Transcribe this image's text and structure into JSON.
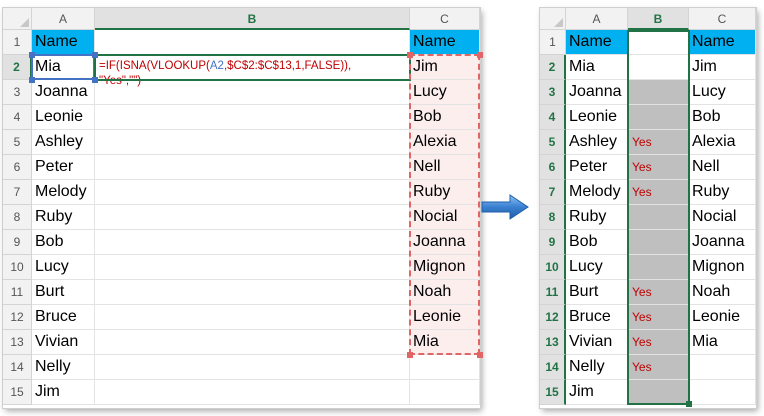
{
  "left_sheet": {
    "columns": [
      "A",
      "B",
      "C"
    ],
    "selected_column": "B",
    "active_row": "2",
    "rows": [
      {
        "num": "1",
        "a": "Name",
        "c": "Name"
      },
      {
        "num": "2",
        "a": "Mia",
        "c": "Jim"
      },
      {
        "num": "3",
        "a": "Joanna",
        "c": "Lucy"
      },
      {
        "num": "4",
        "a": "Leonie",
        "c": "Bob"
      },
      {
        "num": "5",
        "a": "Ashley",
        "c": "Alexia"
      },
      {
        "num": "6",
        "a": "Peter",
        "c": "Nell"
      },
      {
        "num": "7",
        "a": "Melody",
        "c": "Ruby"
      },
      {
        "num": "8",
        "a": "Ruby",
        "c": "Nocial"
      },
      {
        "num": "9",
        "a": "Bob",
        "c": "Joanna"
      },
      {
        "num": "10",
        "a": "Lucy",
        "c": "Mignon"
      },
      {
        "num": "11",
        "a": "Burt",
        "c": "Noah"
      },
      {
        "num": "12",
        "a": "Bruce",
        "c": "Leonie"
      },
      {
        "num": "13",
        "a": "Vivian",
        "c": "Mia"
      },
      {
        "num": "14",
        "a": "Nelly",
        "c": ""
      },
      {
        "num": "15",
        "a": "Jim",
        "c": ""
      }
    ],
    "formula": {
      "p1": "=IF(ISNA(VLOOKUP(",
      "p2": "A2",
      "p3": ",",
      "p4": "$C$2:$C$13",
      "p5": ",1,FALSE)),",
      "line2": "\"Yes\",\"\")"
    }
  },
  "right_sheet": {
    "columns": [
      "A",
      "B",
      "C"
    ],
    "selected_column": "B",
    "rows": [
      {
        "num": "1",
        "a": "Name",
        "b": "",
        "c": "Name"
      },
      {
        "num": "2",
        "a": "Mia",
        "b": "",
        "c": "Jim"
      },
      {
        "num": "3",
        "a": "Joanna",
        "b": "",
        "c": "Lucy"
      },
      {
        "num": "4",
        "a": "Leonie",
        "b": "",
        "c": "Bob"
      },
      {
        "num": "5",
        "a": "Ashley",
        "b": "Yes",
        "c": "Alexia"
      },
      {
        "num": "6",
        "a": "Peter",
        "b": "Yes",
        "c": "Nell"
      },
      {
        "num": "7",
        "a": "Melody",
        "b": "Yes",
        "c": "Ruby"
      },
      {
        "num": "8",
        "a": "Ruby",
        "b": "",
        "c": "Nocial"
      },
      {
        "num": "9",
        "a": "Bob",
        "b": "",
        "c": "Joanna"
      },
      {
        "num": "10",
        "a": "Lucy",
        "b": "",
        "c": "Mignon"
      },
      {
        "num": "11",
        "a": "Burt",
        "b": "Yes",
        "c": "Noah"
      },
      {
        "num": "12",
        "a": "Bruce",
        "b": "Yes",
        "c": "Leonie"
      },
      {
        "num": "13",
        "a": "Vivian",
        "b": "Yes",
        "c": "Mia"
      },
      {
        "num": "14",
        "a": "Nelly",
        "b": "Yes",
        "c": ""
      },
      {
        "num": "15",
        "a": "Jim",
        "b": "",
        "c": ""
      }
    ]
  },
  "colors": {
    "header_fill": "#00b0f0",
    "selection_green": "#217346",
    "formula_red": "#c00000",
    "formula_blue": "#4472c4",
    "grey_fill": "#bfbfbf",
    "arrow_blue": "#3a7fd0"
  },
  "icons": {
    "transition": "right-arrow-icon"
  }
}
